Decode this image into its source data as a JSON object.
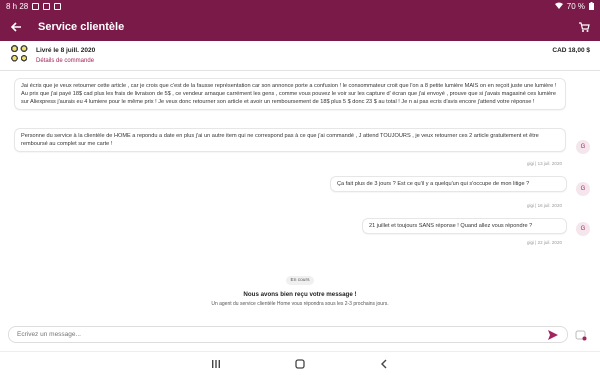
{
  "status_bar": {
    "time": "8 h 28",
    "battery": "70 %"
  },
  "header": {
    "title": "Service clientèle"
  },
  "order": {
    "delivered": "Livré le 8 juill. 2020",
    "details_link": "Détails de commande",
    "price": "CAD 18,00 $"
  },
  "messages": [
    {
      "side": "left",
      "text": "Jai écris que je veux retourner cette article , car je crois que c'est de la fausse représentation car son annonce porte a confusion ! le consommateur croit que l'on a 8 petite lumière MAIS on en reçoit juste une lumière ! Au prix que j'ai payé 18$ cad plus les frais de livraison de 5$ , ce vendeur arnaque carrément les gens , comme vous pouvez le voir sur les capture d' écran que j'ai envoyé , prouve que si j'avais magasiné ces lumière sur Aliexpress j'aurais eu 4 lumiere pour le même prix ! Je veux donc retourner son article et avoir un remboursement de 18$ plus 5 $ donc 23 $ au total ! Je n ai pas ecris d'avis encore j'attend votre réponse !",
      "timestamp": ""
    },
    {
      "side": "left",
      "text": "Personne du service à la clientèle de HOME a repondu a date en plus j'ai un autre item qui ne correspond pas à ce que j'ai commandé , J attend TOUJOURS , je veux retourner ces 2 article gratuitement et être remboursé au complet sur me carte !",
      "timestamp": "gigi | 13 juil. 2020",
      "avatar": "G"
    },
    {
      "side": "right",
      "text": "Ça fait plus de 3 jours ? Est ce qu'il y a quelqu'un qui s'occupe de mon litige ?",
      "timestamp": "gigi | 16 juil. 2020",
      "avatar": "G"
    },
    {
      "side": "right",
      "text": "21 juillet et toujours SANS réponse ! Quand allez vous répondre ?",
      "timestamp": "gigi | 22 juil. 2020",
      "avatar": "G"
    }
  ],
  "status_block": {
    "pill": "En cours",
    "title": "Nous avons bien reçu votre message !",
    "subtitle": "Un agent du service clientèle Home vous répondra sous les 2-3 prochains jours."
  },
  "composer": {
    "placeholder": "Écrivez un message..."
  },
  "colors": {
    "brand": "#7a1a48",
    "accent": "#a3245e"
  },
  "icons": [
    "back-arrow-icon",
    "cart-icon",
    "send-icon",
    "attach-icon",
    "recents-icon",
    "home-icon",
    "back-nav-icon"
  ]
}
